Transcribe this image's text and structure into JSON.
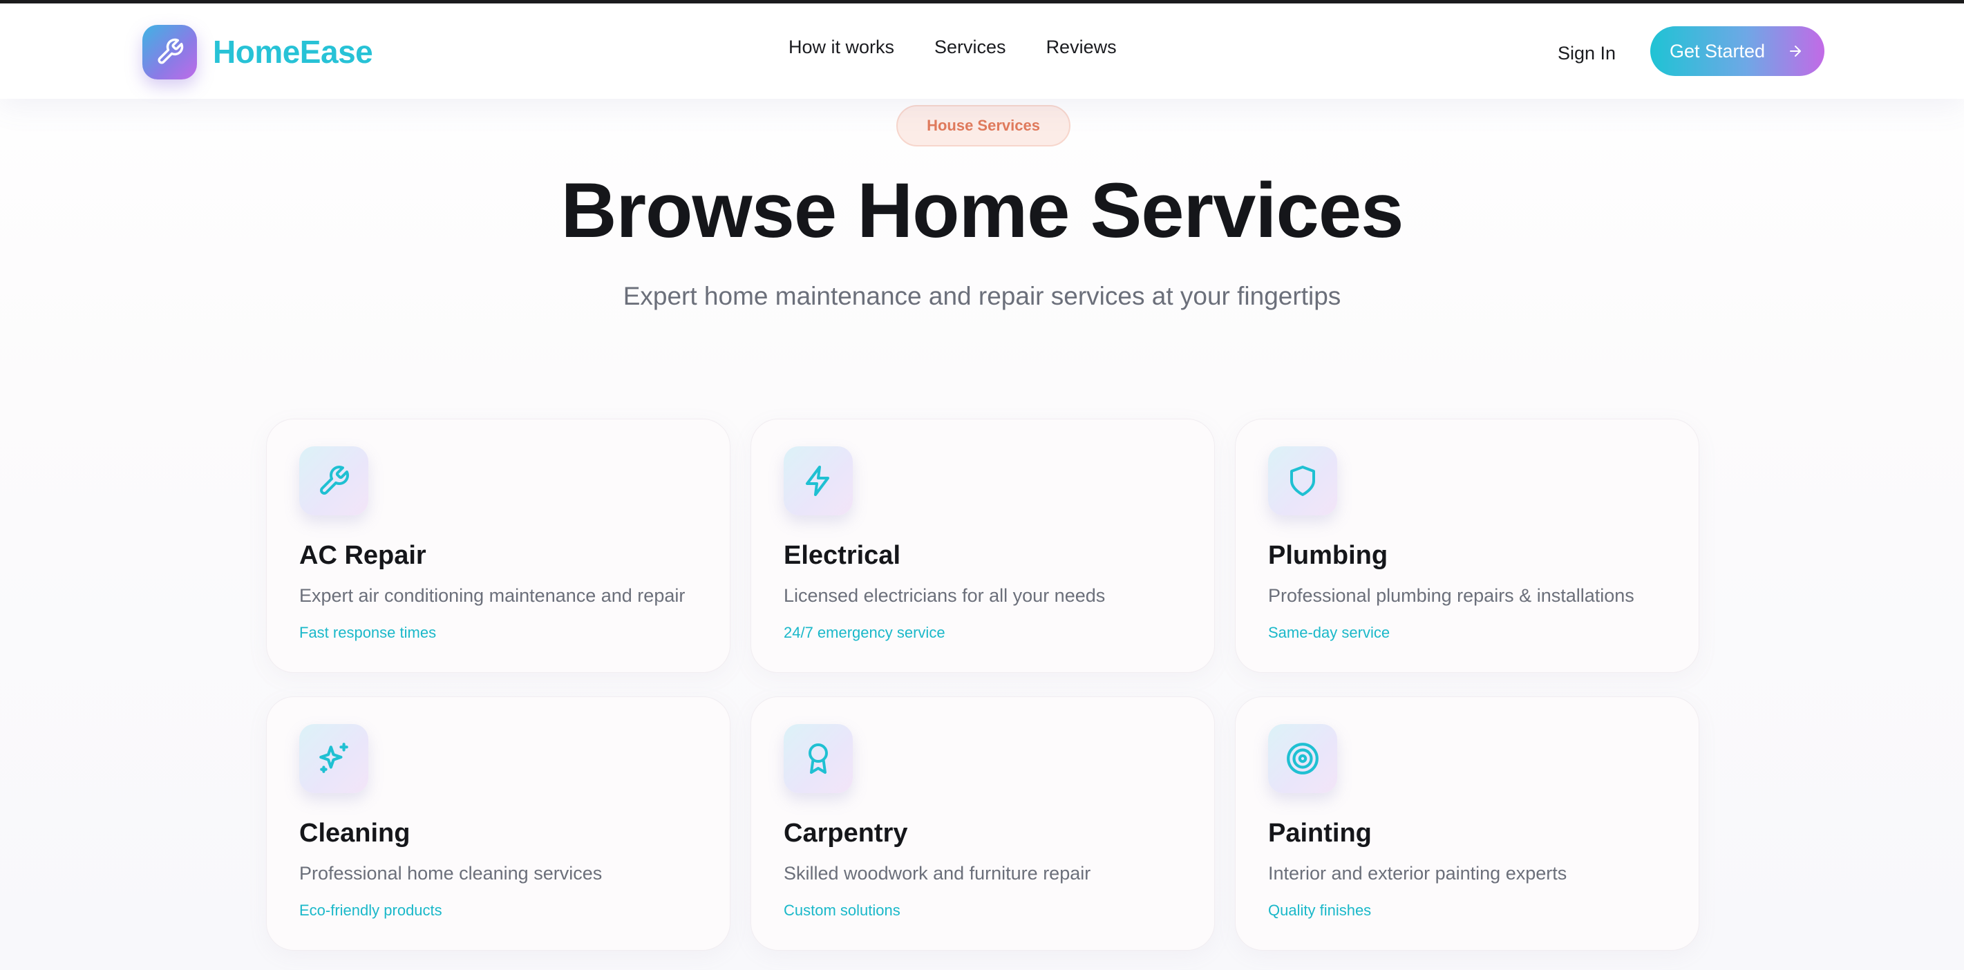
{
  "brand": {
    "name": "HomeEase",
    "icon": "wrench-icon"
  },
  "nav": {
    "links": [
      "How it works",
      "Services",
      "Reviews"
    ],
    "sign_in": "Sign In",
    "cta": "Get Started"
  },
  "hero": {
    "badge": "House Services",
    "title": "Browse Home Services",
    "subtitle": "Expert home maintenance and repair services at your fingertips"
  },
  "colors": {
    "accent": "#27c2d6",
    "gradient_start": "#1fc3d4",
    "gradient_end": "#c26ae6",
    "badge_text": "#e07a5c"
  },
  "services": [
    {
      "title": "AC Repair",
      "description": "Expert air conditioning maintenance and repair",
      "tag": "Fast response times",
      "icon": "wrench-icon"
    },
    {
      "title": "Electrical",
      "description": "Licensed electricians for all your needs",
      "tag": "24/7 emergency service",
      "icon": "lightning-icon"
    },
    {
      "title": "Plumbing",
      "description": "Professional plumbing repairs & installations",
      "tag": "Same-day service",
      "icon": "shield-icon"
    },
    {
      "title": "Cleaning",
      "description": "Professional home cleaning services",
      "tag": "Eco-friendly products",
      "icon": "sparkles-icon"
    },
    {
      "title": "Carpentry",
      "description": "Skilled woodwork and furniture repair",
      "tag": "Custom solutions",
      "icon": "award-icon"
    },
    {
      "title": "Painting",
      "description": "Interior and exterior painting experts",
      "tag": "Quality finishes",
      "icon": "target-icon"
    }
  ]
}
